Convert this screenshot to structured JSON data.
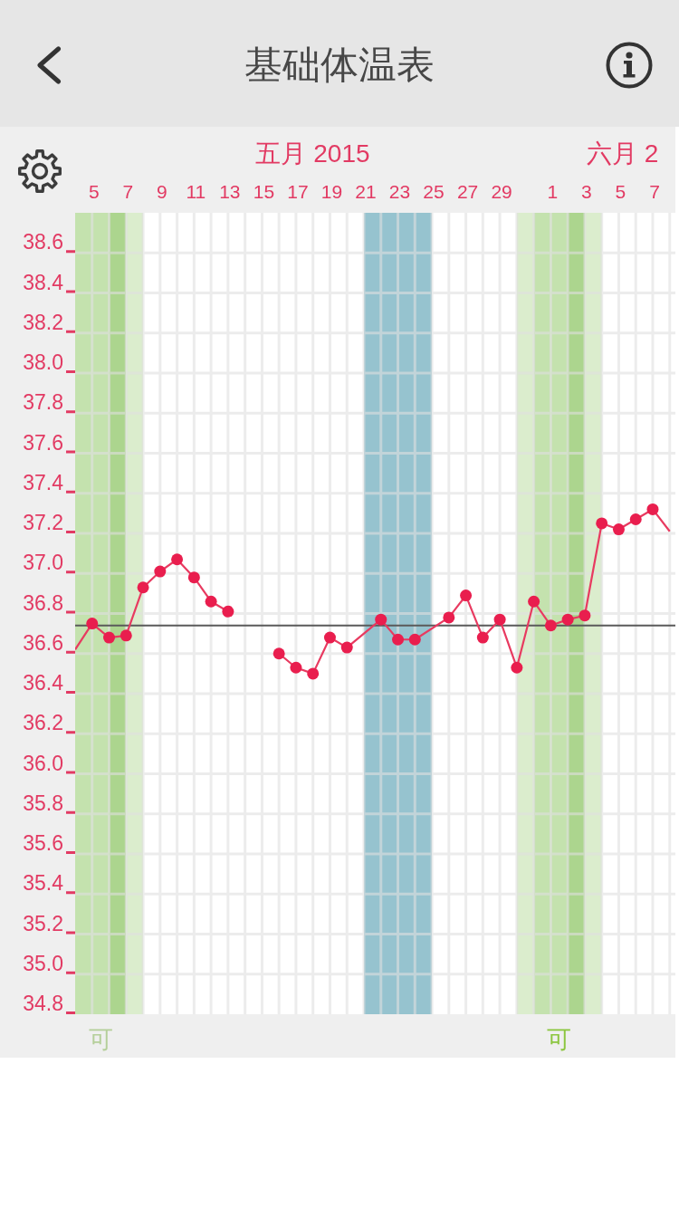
{
  "nav_bar": {
    "title": "基础体温表"
  },
  "chart": {
    "months": [
      {
        "label": "五月 2015"
      },
      {
        "label": "六月 2"
      }
    ],
    "chart_data": {
      "type": "line",
      "x": [
        "2015-05-04",
        "2015-05-05",
        "2015-05-06",
        "2015-05-07",
        "2015-05-08",
        "2015-05-09",
        "2015-05-10",
        "2015-05-11",
        "2015-05-12",
        "2015-05-13",
        "2015-05-16",
        "2015-05-17",
        "2015-05-18",
        "2015-05-19",
        "2015-05-20",
        "2015-05-22",
        "2015-05-23",
        "2015-05-24",
        "2015-05-26",
        "2015-05-27",
        "2015-05-28",
        "2015-05-29",
        "2015-05-30",
        "2015-05-31",
        "2015-06-01",
        "2015-06-02",
        "2015-06-03",
        "2015-06-04",
        "2015-06-05",
        "2015-06-06",
        "2015-06-07",
        "2015-06-08"
      ],
      "series": [
        {
          "values": [
            36.62,
            36.75,
            36.68,
            36.69,
            36.93,
            37.01,
            37.07,
            36.98,
            36.86,
            36.81,
            null,
            null,
            null,
            null,
            null,
            null,
            null,
            null,
            null,
            null,
            null,
            null,
            null,
            null,
            null,
            null,
            null,
            null,
            null,
            null,
            null,
            null
          ]
        },
        {
          "values": [
            null,
            null,
            null,
            null,
            null,
            null,
            null,
            null,
            null,
            null,
            36.6,
            36.53,
            36.5,
            36.68,
            36.63,
            36.77,
            36.67,
            36.67,
            36.78,
            36.89,
            36.68,
            36.77,
            36.53,
            36.86,
            36.74,
            36.77,
            36.79,
            37.25,
            37.22,
            37.27,
            37.32,
            37.21
          ]
        }
      ],
      "xlim": [
        "2015-05-04",
        "2015-06-08T08:00"
      ],
      "xticks": [
        {
          "value": "2015-05-05",
          "label": "5"
        },
        {
          "value": "2015-05-07",
          "label": "7"
        },
        {
          "value": "2015-05-09",
          "label": "9"
        },
        {
          "value": "2015-05-11",
          "label": "11"
        },
        {
          "value": "2015-05-13",
          "label": "13"
        },
        {
          "value": "2015-05-15",
          "label": "15"
        },
        {
          "value": "2015-05-17",
          "label": "17"
        },
        {
          "value": "2015-05-19",
          "label": "19"
        },
        {
          "value": "2015-05-21",
          "label": "21"
        },
        {
          "value": "2015-05-23",
          "label": "23"
        },
        {
          "value": "2015-05-25",
          "label": "25"
        },
        {
          "value": "2015-05-27",
          "label": "27"
        },
        {
          "value": "2015-05-29",
          "label": "29"
        },
        {
          "value": "2015-06-01",
          "label": "1"
        },
        {
          "value": "2015-06-03",
          "label": "3"
        },
        {
          "value": "2015-06-05",
          "label": "5"
        },
        {
          "value": "2015-06-07",
          "label": "7"
        }
      ],
      "ylim": [
        34.8,
        38.8
      ],
      "yticks": [
        {
          "value": 38.6,
          "label": "38.6"
        },
        {
          "value": 38.4,
          "label": "38.4"
        },
        {
          "value": 38.2,
          "label": "38.2"
        },
        {
          "value": 38.0,
          "label": "38.0"
        },
        {
          "value": 37.8,
          "label": "37.8"
        },
        {
          "value": 37.6,
          "label": "37.6"
        },
        {
          "value": 37.4,
          "label": "37.4"
        },
        {
          "value": 37.2,
          "label": "37.2"
        },
        {
          "value": 37.0,
          "label": "37.0"
        },
        {
          "value": 36.8,
          "label": "36.8"
        },
        {
          "value": 36.6,
          "label": "36.6"
        },
        {
          "value": 36.4,
          "label": "36.4"
        },
        {
          "value": 36.2,
          "label": "36.2"
        },
        {
          "value": 36.0,
          "label": "36.0"
        },
        {
          "value": 35.8,
          "label": "35.8"
        },
        {
          "value": 35.6,
          "label": "35.6"
        },
        {
          "value": 35.4,
          "label": "35.4"
        },
        {
          "value": 35.2,
          "label": "35.2"
        },
        {
          "value": 35.0,
          "label": "35.0"
        },
        {
          "value": 34.8,
          "label": "34.8"
        }
      ],
      "grid": true,
      "marker": "circle",
      "ref_lines": [
        {
          "axis": "y",
          "value": 36.74
        }
      ],
      "bands": [
        {
          "axis": "x",
          "from": "2015-05-04",
          "to": "2015-05-05",
          "color": "#c4e2ae"
        },
        {
          "axis": "x",
          "from": "2015-05-05",
          "to": "2015-05-06",
          "color": "#c4e2ae",
          "label": "可"
        },
        {
          "axis": "x",
          "from": "2015-05-06",
          "to": "2015-05-07",
          "color": "#acd58e"
        },
        {
          "axis": "x",
          "from": "2015-05-07",
          "to": "2015-05-08",
          "color": "#dbedcd"
        },
        {
          "axis": "x",
          "from": "2015-05-21",
          "to": "2015-05-25",
          "color": "#96c3cf"
        },
        {
          "axis": "x",
          "from": "2015-05-30",
          "to": "2015-05-31",
          "color": "#dbedcd"
        },
        {
          "axis": "x",
          "from": "2015-05-31",
          "to": "2015-06-01",
          "color": "#c4e2ae"
        },
        {
          "axis": "x",
          "from": "2015-06-01",
          "to": "2015-06-02",
          "color": "#c4e2ae",
          "label": "可"
        },
        {
          "axis": "x",
          "from": "2015-06-02",
          "to": "2015-06-03",
          "color": "#acd58e"
        },
        {
          "axis": "x",
          "from": "2015-06-03",
          "to": "2015-06-04",
          "color": "#dbedcd"
        }
      ]
    },
    "band_labels": [
      {
        "muted": true
      },
      {
        "muted": false
      }
    ]
  }
}
